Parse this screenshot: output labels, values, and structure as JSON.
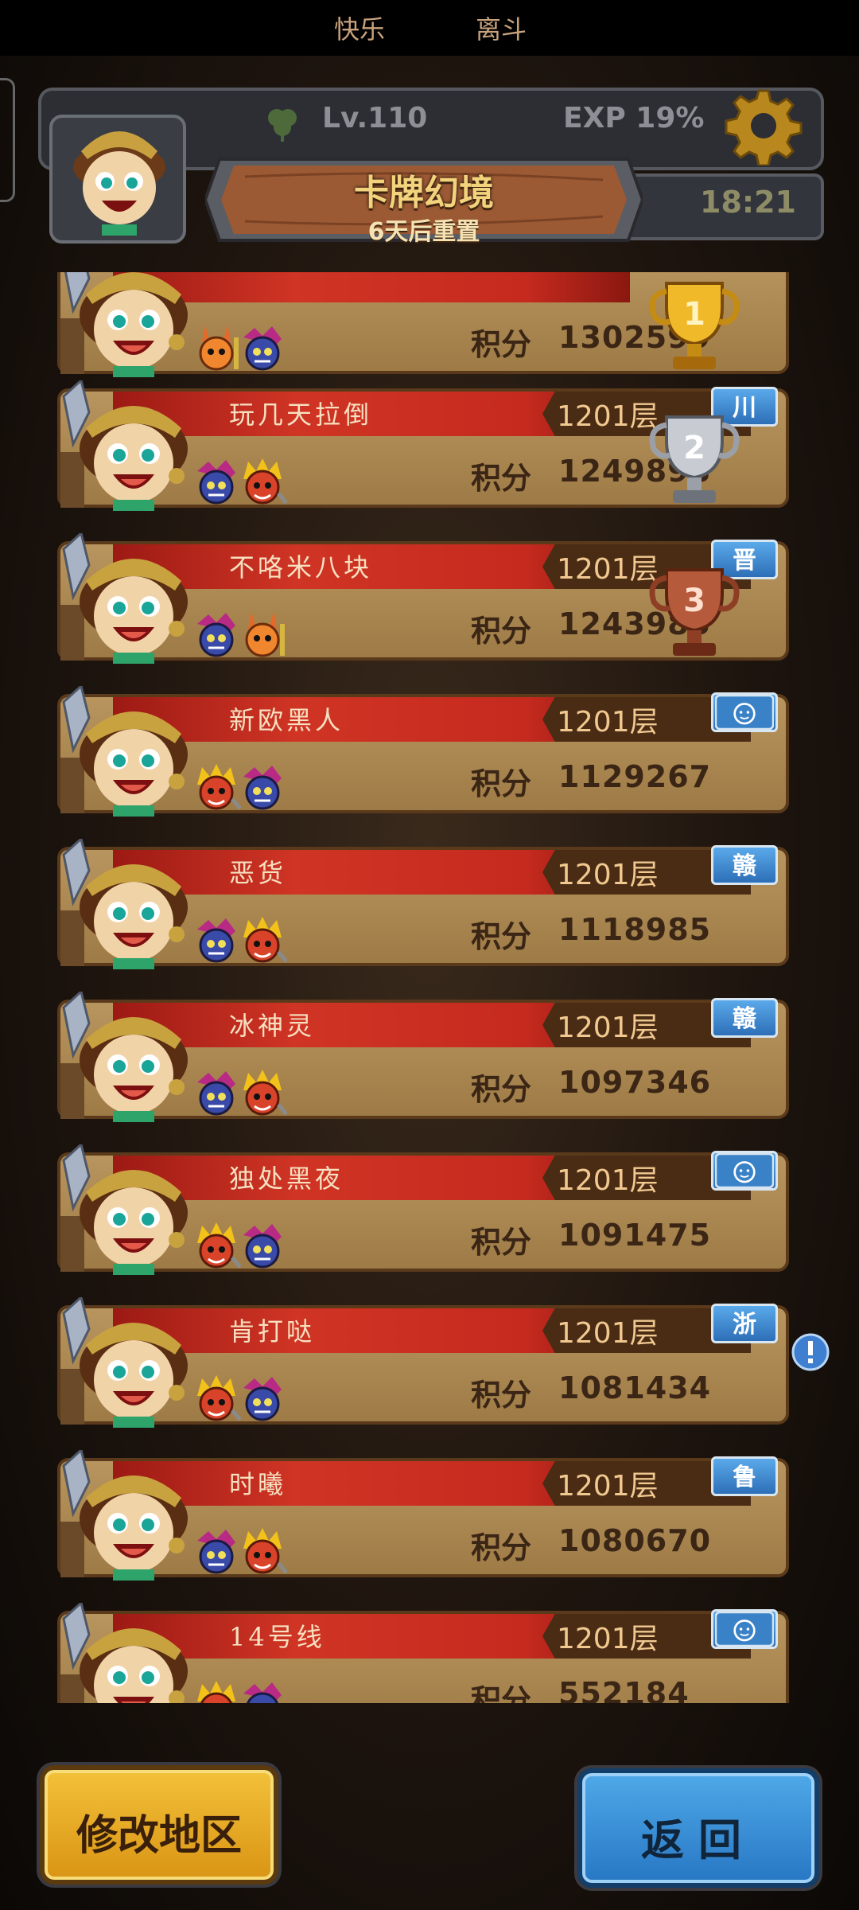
{
  "top_strip": {
    "left_text": "快乐",
    "right_text": "离斗"
  },
  "player": {
    "level": "Lv.110",
    "exp": "EXP 19%",
    "clock": "18:21"
  },
  "event": {
    "title": "卡牌幻境",
    "subtitle": "6天后重置"
  },
  "ranking": [
    {
      "name": "",
      "floor": "",
      "score_label": "积分",
      "score": "1302599",
      "region": "",
      "trophy": "gold"
    },
    {
      "name": "玩几天拉倒",
      "floor": "1201层",
      "score_label": "积分",
      "score": "1249898",
      "region": "川",
      "trophy": "silver"
    },
    {
      "name": "不咯米八块",
      "floor": "1201层",
      "score_label": "积分",
      "score": "1243985",
      "region": "晋",
      "trophy": "bronze"
    },
    {
      "name": "新欧黑人",
      "floor": "1201层",
      "score_label": "积分",
      "score": "1129267",
      "region": "face-icon",
      "trophy": ""
    },
    {
      "name": "恶货",
      "floor": "1201层",
      "score_label": "积分",
      "score": "1118985",
      "region": "赣",
      "trophy": ""
    },
    {
      "name": "冰神灵",
      "floor": "1201层",
      "score_label": "积分",
      "score": "1097346",
      "region": "赣",
      "trophy": ""
    },
    {
      "name": "独处黑夜",
      "floor": "1201层",
      "score_label": "积分",
      "score": "1091475",
      "region": "face-icon",
      "trophy": ""
    },
    {
      "name": "肯打哒",
      "floor": "1201层",
      "score_label": "积分",
      "score": "1081434",
      "region": "浙",
      "trophy": ""
    },
    {
      "name": "时曦",
      "floor": "1201层",
      "score_label": "积分",
      "score": "1080670",
      "region": "鲁",
      "trophy": ""
    },
    {
      "name": "14号线",
      "floor": "1201层",
      "score_label": "积分",
      "score": "552184",
      "region": "face-icon",
      "trophy": ""
    }
  ],
  "buttons": {
    "modify_region": "修改地区",
    "back": "返回"
  },
  "colors": {
    "name_band": "#c52a1e",
    "card": "#b8955e",
    "badge": "#2d6fb7",
    "gold_button": "#f3c13a",
    "blue_button": "#4fa9e8"
  }
}
